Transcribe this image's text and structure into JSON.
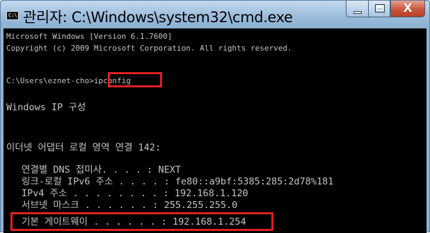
{
  "window": {
    "title": "관리자: C:\\Windows\\system32\\cmd.exe",
    "icon": "console-icon",
    "icon_text": "C:\\",
    "controls": {
      "minimize": "minimize-icon",
      "maximize": "maximize-icon",
      "close": "close-icon",
      "close_glyph": "X"
    }
  },
  "console": {
    "version_line": "Microsoft Windows [Version 6.1.7600]",
    "copyright_line": "Copyright (c) 2009 Microsoft Corporation. All rights reserved.",
    "prompt": "C:\\Users\\eznet-cho>",
    "command": "ipconfig",
    "heading": "Windows IP 구성",
    "adapter_header": "이더넷 어댑터 로컬 영역 연결 142:",
    "rows": [
      {
        "label": "연결별 DNS 접미사. . . . :",
        "value": "NEXT"
      },
      {
        "label": "링크-로컬 IPv6 주소 . . . . :",
        "value": "fe80::a9bf:5385:285:2d78%181"
      },
      {
        "label": "IPv4 주소 . . . . . . . . :",
        "value": "192.168.1.120"
      },
      {
        "label": "서브넷 마스크 . . . . . . :",
        "value": "255.255.255.0"
      },
      {
        "label": "기본 게이트웨이 . . . . . . :",
        "value": "192.168.1.254"
      }
    ]
  },
  "highlight_color": "#e02020"
}
